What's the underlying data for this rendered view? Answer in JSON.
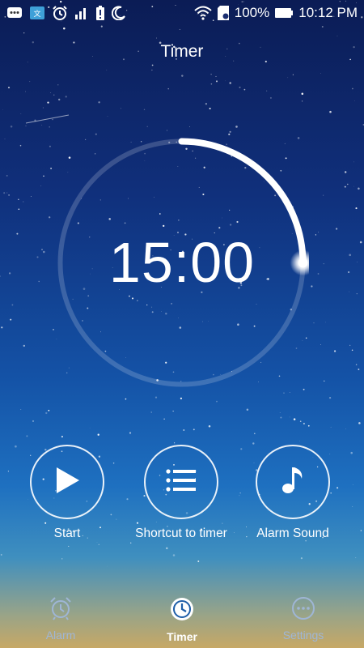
{
  "statusbar": {
    "battery_percent": "100%",
    "time": "10:12 PM",
    "left_icons": [
      "message-icon",
      "app-icon",
      "alarm-clock-icon",
      "signal-icon",
      "battery-alert-icon",
      "moon-icon"
    ],
    "right_icons": [
      "wifi-icon",
      "sd-card-icon",
      "battery-icon"
    ]
  },
  "header": {
    "title": "Timer"
  },
  "timer": {
    "display": "15:00",
    "progress": 0.25
  },
  "controls": [
    {
      "label": "Start",
      "icon": "play-icon"
    },
    {
      "label": "Shortcut to timer",
      "icon": "list-icon"
    },
    {
      "label": "Alarm Sound",
      "icon": "music-note-icon"
    }
  ],
  "nav": {
    "items": [
      {
        "label": "Alarm",
        "icon": "alarm-clock-icon",
        "active": false
      },
      {
        "label": "Timer",
        "icon": "timer-icon",
        "active": true
      },
      {
        "label": "Settings",
        "icon": "settings-icon",
        "active": false
      }
    ]
  },
  "colors": {
    "background_top": "#0b1c55",
    "background_bottom": "#c7a865",
    "active": "#ffffff",
    "inactive": "#9fb6d6"
  }
}
